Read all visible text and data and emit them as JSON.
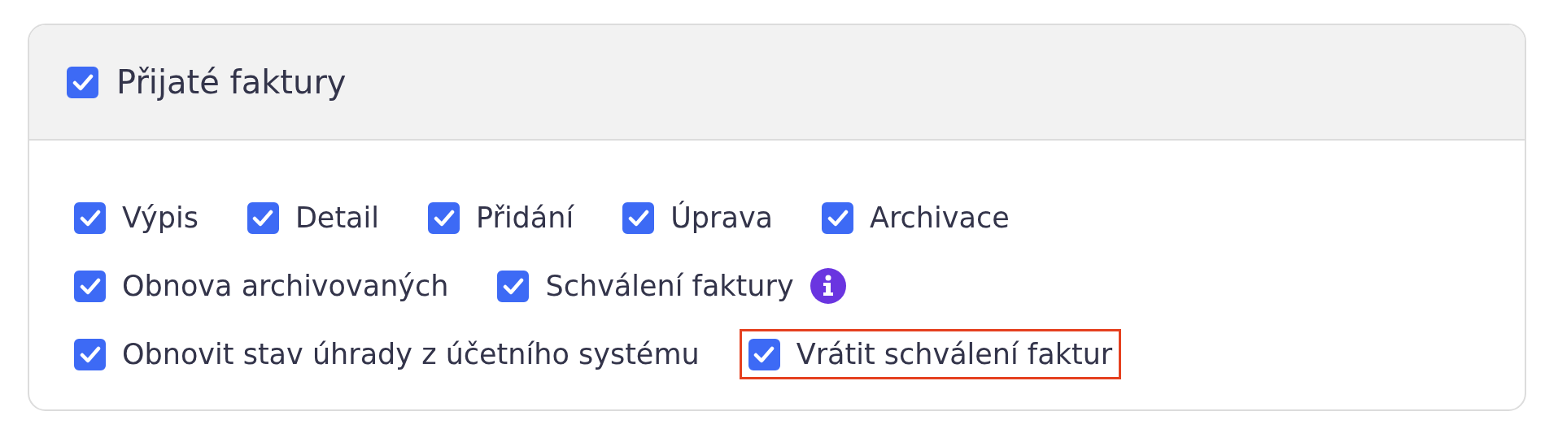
{
  "section": {
    "title": "Přijaté faktury",
    "checked": true
  },
  "rows": [
    [
      {
        "label": "Výpis",
        "checked": true,
        "info": false,
        "highlighted": false
      },
      {
        "label": "Detail",
        "checked": true,
        "info": false,
        "highlighted": false
      },
      {
        "label": "Přidání",
        "checked": true,
        "info": false,
        "highlighted": false
      },
      {
        "label": "Úprava",
        "checked": true,
        "info": false,
        "highlighted": false
      },
      {
        "label": "Archivace",
        "checked": true,
        "info": false,
        "highlighted": false
      }
    ],
    [
      {
        "label": "Obnova archivovaných",
        "checked": true,
        "info": false,
        "highlighted": false
      },
      {
        "label": "Schválení faktury",
        "checked": true,
        "info": true,
        "highlighted": false
      }
    ],
    [
      {
        "label": "Obnovit stav úhrady z účetního systému",
        "checked": true,
        "info": false,
        "highlighted": false
      },
      {
        "label": "Vrátit schválení faktur",
        "checked": true,
        "info": false,
        "highlighted": true
      }
    ]
  ]
}
